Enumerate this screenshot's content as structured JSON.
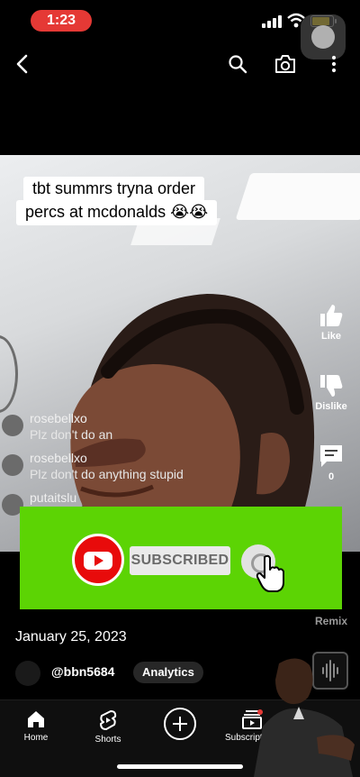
{
  "status_bar": {
    "time": "1:23"
  },
  "top_nav": {
    "back_icon": "back-arrow-icon",
    "search_icon": "search-icon",
    "camera_icon": "camera-icon",
    "more_icon": "more-vert-icon"
  },
  "video": {
    "caption_line1": "tbt summrs tryna order",
    "caption_line2": "percs at mcdonalds 😭😭",
    "comments": [
      {
        "user": "rosebellxo",
        "text": "Plz don't do an"
      },
      {
        "user": "rosebellxo",
        "text": "Plz don't do anything stupid"
      },
      {
        "user": "putaitslu",
        "text": ""
      }
    ]
  },
  "actions": {
    "like_label": "Like",
    "dislike_label": "Dislike",
    "comments_count": "0",
    "remix_label": "Remix"
  },
  "overlay": {
    "subscribed_label": "SUBSCRIBED",
    "green_color": "#5cd404",
    "brand_red": "#e80b0b"
  },
  "meta": {
    "date": "January 25, 2023",
    "channel": "@bbn5684",
    "analytics_label": "Analytics"
  },
  "bottom_nav": {
    "home": "Home",
    "shorts": "Shorts",
    "create_icon": "plus-circle-icon",
    "subscriptions": "Subscriptions"
  }
}
